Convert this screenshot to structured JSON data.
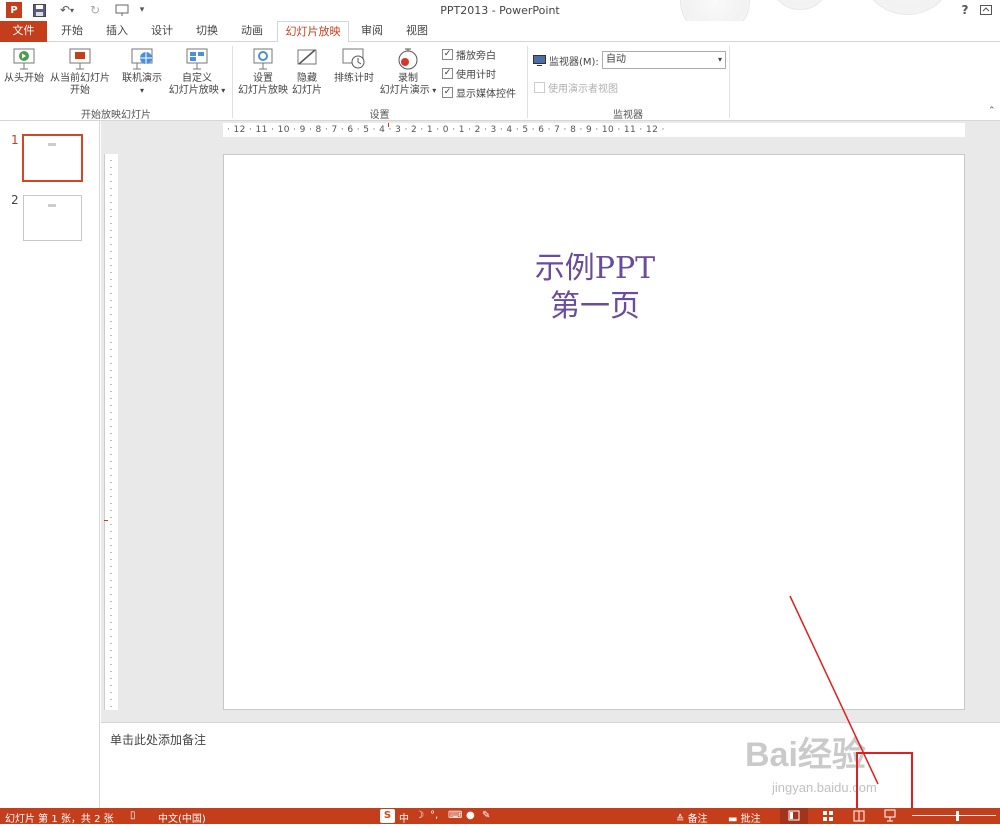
{
  "title": "PPT2013 - PowerPoint",
  "help": "?",
  "tabs": [
    {
      "label": "文件"
    },
    {
      "label": "开始"
    },
    {
      "label": "插入"
    },
    {
      "label": "设计"
    },
    {
      "label": "切换"
    },
    {
      "label": "动画"
    },
    {
      "label": "幻灯片放映"
    },
    {
      "label": "审阅"
    },
    {
      "label": "视图"
    }
  ],
  "active_tab": "幻灯片放映",
  "ribbon": {
    "group1": {
      "label": "开始放映幻灯片",
      "from_start": "从头开始",
      "from_current_l1": "从当前幻灯片",
      "from_current_l2": "开始",
      "online": "联机演示",
      "custom_l1": "自定义",
      "custom_l2": "幻灯片放映"
    },
    "group2": {
      "label": "设置",
      "setup_l1": "设置",
      "setup_l2": "幻灯片放映",
      "hide_l1": "隐藏",
      "hide_l2": "幻灯片",
      "rehearse": "排练计时",
      "record_l1": "录制",
      "record_l2": "幻灯片演示",
      "chk_narration": "播放旁白",
      "chk_timing": "使用计时",
      "chk_media": "显示媒体控件"
    },
    "group3": {
      "label": "监视器",
      "monitor_label": "监视器(M):",
      "monitor_value": "自动",
      "presenter_view": "使用演示者视图"
    }
  },
  "hruler_text": "· 12 · 11 · 10 · 9 · 8 · 7 · 6 · 5 · 4 · 3 · 2 · 1 · 0 · 1 · 2 · 3 · 4 · 5 · 6 · 7 · 8 · 9 · 10 · 11 · 12 ·",
  "slides": [
    {
      "number": "1"
    },
    {
      "number": "2"
    }
  ],
  "slide": {
    "title_line1": "示例PPT",
    "title_line2": "第一页"
  },
  "notes_placeholder": "单击此处添加备注",
  "status": {
    "slide_info": "幻灯片 第 1 张，共 2 张",
    "language": "中文(中国)",
    "ime": "中",
    "notes_btn": "备注",
    "comments_btn": "批注"
  },
  "watermark": {
    "brand": "Bai经验",
    "url": "jingyan.baidu.com"
  },
  "colors": {
    "accent": "#c43e1c",
    "slide_text": "#6a4c9c",
    "annotation": "#e02020"
  }
}
